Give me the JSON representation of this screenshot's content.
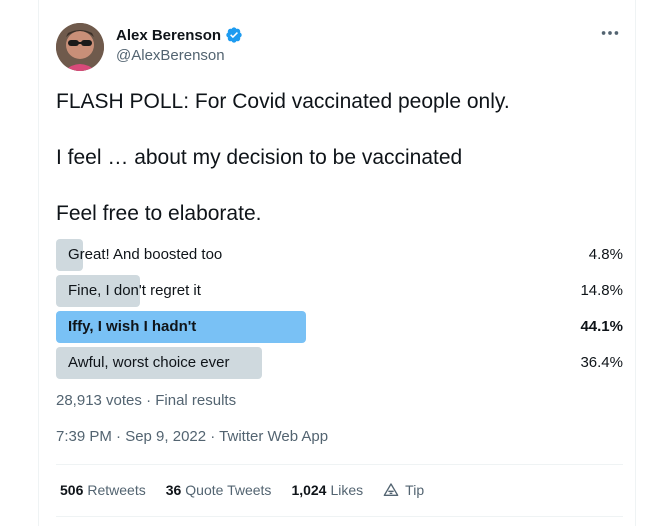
{
  "author": {
    "name": "Alex Berenson",
    "handle": "@AlexBerenson"
  },
  "tweet": {
    "line1": "FLASH POLL: For Covid vaccinated people only.",
    "line2": "I feel … about my decision to be vaccinated",
    "line3": "Feel free to elaborate."
  },
  "poll": {
    "options": [
      {
        "label": "Great! And boosted too",
        "percent": "4.8%",
        "value": 4.8,
        "winner": false
      },
      {
        "label": "Fine, I don't regret it",
        "percent": "14.8%",
        "value": 14.8,
        "winner": false
      },
      {
        "label": "Iffy, I wish I hadn't",
        "percent": "44.1%",
        "value": 44.1,
        "winner": true
      },
      {
        "label": "Awful, worst choice ever",
        "percent": "36.4%",
        "value": 36.4,
        "winner": false
      }
    ],
    "summary": "28,913 votes · Final results"
  },
  "timestamp": "7:39 PM · Sep 9, 2022 · Twitter Web App",
  "stats": {
    "retweets_count": "506",
    "retweets_label": "Retweets",
    "quotes_count": "36",
    "quotes_label": "Quote Tweets",
    "likes_count": "1,024",
    "likes_label": "Likes",
    "tip_label": "Tip"
  },
  "colors": {
    "winner_bar": "#79c1f5",
    "bar": "#cfd9de",
    "verified": "#1d9bf0"
  }
}
